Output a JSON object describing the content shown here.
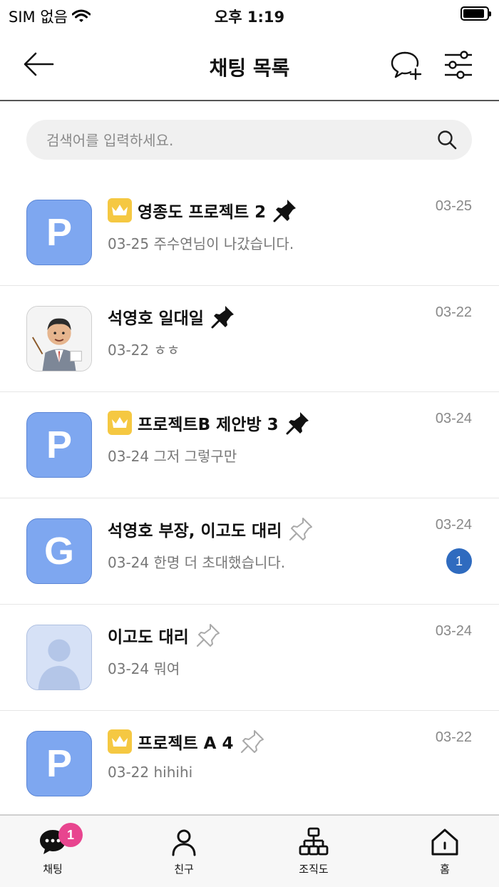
{
  "status_bar": {
    "carrier": "SIM 없음",
    "time": "오후 1:19"
  },
  "header": {
    "title": "채팅 목록"
  },
  "search": {
    "placeholder": "검색어를 입력하세요."
  },
  "chats": [
    {
      "avatar_type": "letter",
      "avatar_letter": "P",
      "has_crown": true,
      "name": "영종도 프로젝트 2",
      "pinned": true,
      "preview": "03-25 주수연님이 나갔습니다.",
      "date": "03-25",
      "unread": ""
    },
    {
      "avatar_type": "photo",
      "avatar_letter": "",
      "has_crown": false,
      "name": "석영호 일대일",
      "pinned": true,
      "preview": "03-22 ㅎㅎ",
      "date": "03-22",
      "unread": ""
    },
    {
      "avatar_type": "letter",
      "avatar_letter": "P",
      "has_crown": true,
      "name": "프로젝트B 제안방 3",
      "pinned": true,
      "preview": "03-24 그저 그렇구만",
      "date": "03-24",
      "unread": ""
    },
    {
      "avatar_type": "letter",
      "avatar_letter": "G",
      "has_crown": false,
      "name": "석영호 부장, 이고도 대리",
      "pinned": false,
      "preview": "03-24 한명 더 초대했습니다.",
      "date": "03-24",
      "unread": "1"
    },
    {
      "avatar_type": "default",
      "avatar_letter": "",
      "has_crown": false,
      "name": "이고도 대리",
      "pinned": false,
      "preview": "03-24 뭐여",
      "date": "03-24",
      "unread": ""
    },
    {
      "avatar_type": "letter",
      "avatar_letter": "P",
      "has_crown": true,
      "name": "프로젝트 A 4",
      "pinned": false,
      "preview": "03-22 hihihi",
      "date": "03-22",
      "unread": ""
    }
  ],
  "tabs": [
    {
      "label": "채팅",
      "icon": "chat-bubble-icon",
      "badge": "1"
    },
    {
      "label": "친구",
      "icon": "person-icon",
      "badge": ""
    },
    {
      "label": "조직도",
      "icon": "org-chart-icon",
      "badge": ""
    },
    {
      "label": "홈",
      "icon": "home-icon",
      "badge": ""
    }
  ],
  "colors": {
    "accent": "#2f6bbf",
    "avatar_blue": "#7ea7f0",
    "crown": "#f5c842",
    "tab_badge": "#e8458f"
  }
}
